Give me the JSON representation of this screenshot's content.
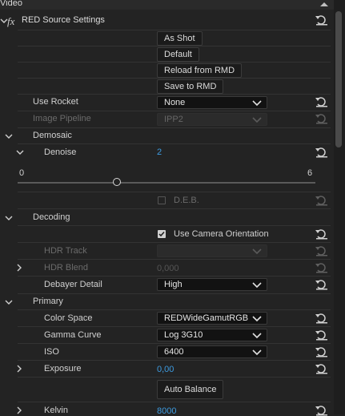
{
  "header": {
    "title": "Video"
  },
  "effect": {
    "fx_label": "fx",
    "name": "RED Source Settings"
  },
  "buttons": {
    "as_shot": "As Shot",
    "default": "Default",
    "reload": "Reload from RMD",
    "save": "Save to RMD",
    "auto_balance": "Auto Balance"
  },
  "params": {
    "use_rocket": {
      "label": "Use Rocket",
      "value": "None"
    },
    "image_pipeline": {
      "label": "Image Pipeline",
      "value": "IPP2"
    },
    "demosaic": {
      "label": "Demosaic"
    },
    "denoise": {
      "label": "Denoise",
      "value": "2",
      "slider_min": "0",
      "slider_max": "6",
      "slider_level": 2
    },
    "deb": {
      "label": "D.E.B."
    },
    "decoding": {
      "label": "Decoding"
    },
    "use_camera_orientation": {
      "label": "Use Camera Orientation",
      "checked": true
    },
    "hdr_track": {
      "label": "HDR Track"
    },
    "hdr_blend": {
      "label": "HDR Blend",
      "value": "0,000"
    },
    "debayer_detail": {
      "label": "Debayer Detail",
      "value": "High"
    },
    "primary": {
      "label": "Primary"
    },
    "color_space": {
      "label": "Color Space",
      "value": "REDWideGamutRGB"
    },
    "gamma_curve": {
      "label": "Gamma Curve",
      "value": "Log 3G10"
    },
    "iso": {
      "label": "ISO",
      "value": "6400"
    },
    "exposure": {
      "label": "Exposure",
      "value": "0,00"
    },
    "kelvin": {
      "label": "Kelvin",
      "value": "8000"
    }
  },
  "colors": {
    "accent": "#3d9be0",
    "background": "#232323"
  },
  "icons": {
    "reset": "reset-arrow-icon",
    "collapse": "chevron-down-icon",
    "expand": "chevron-right-icon",
    "scroll_up": "caret-up-icon",
    "checkbox": "checkbox-icon"
  }
}
